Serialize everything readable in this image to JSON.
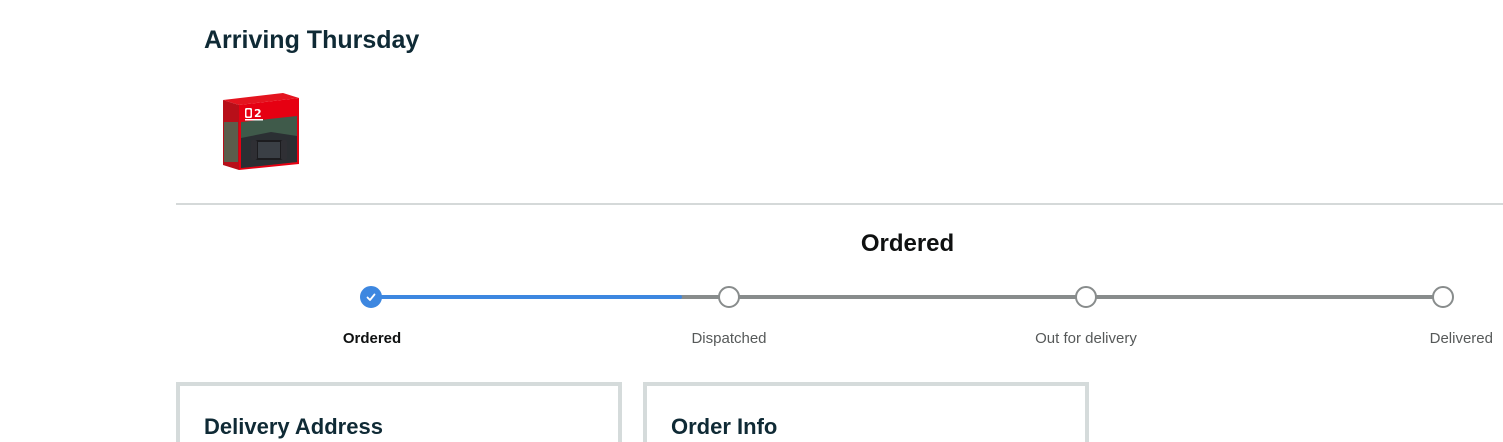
{
  "shipment": {
    "arriving_title": "Arriving Thursday",
    "product_image_alt": "Nintendo Switch 2 console box"
  },
  "tracker": {
    "current_status": "Ordered",
    "progress_fraction": 0.29,
    "accent_color": "#3d87e0",
    "steps": [
      {
        "label": "Ordered",
        "state": "done"
      },
      {
        "label": "Dispatched",
        "state": "pending"
      },
      {
        "label": "Out for delivery",
        "state": "pending"
      },
      {
        "label": "Delivered",
        "state": "pending"
      }
    ]
  },
  "cards": {
    "delivery_address_title": "Delivery Address",
    "order_info_title": "Order Info"
  },
  "icons": {
    "check": "check-icon"
  }
}
